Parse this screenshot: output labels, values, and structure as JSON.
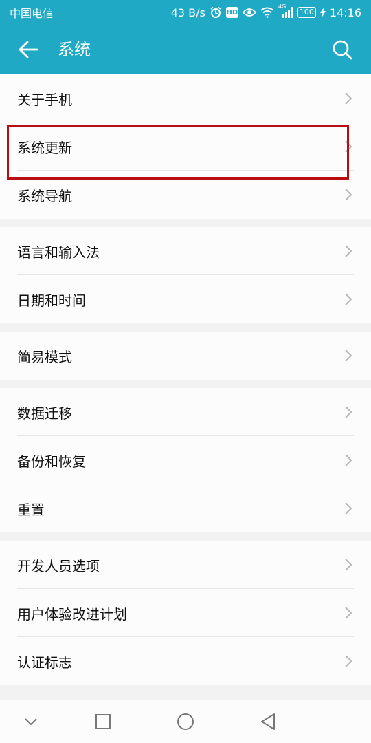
{
  "status_bar": {
    "carrier": "中国电信",
    "speed": "43 B/s",
    "network": "4G",
    "battery": "100",
    "time": "14:16",
    "hd_badge": "HD"
  },
  "app_bar": {
    "title": "系统",
    "back_icon": "arrow-left-icon",
    "search_icon": "search-icon"
  },
  "groups": [
    [
      "关于手机",
      "系统更新",
      "系统导航"
    ],
    [
      "语言和输入法",
      "日期和时间"
    ],
    [
      "简易模式"
    ],
    [
      "数据迁移",
      "备份和恢复",
      "重置"
    ],
    [
      "开发人员选项",
      "用户体验改进计划",
      "认证标志"
    ]
  ],
  "colors": {
    "accent": "#1fa9c4",
    "highlight_box": "#b80d12"
  },
  "nav_bar": {
    "icons": [
      "chevron-down-icon",
      "square-recents-icon",
      "circle-home-icon",
      "triangle-back-icon"
    ]
  }
}
